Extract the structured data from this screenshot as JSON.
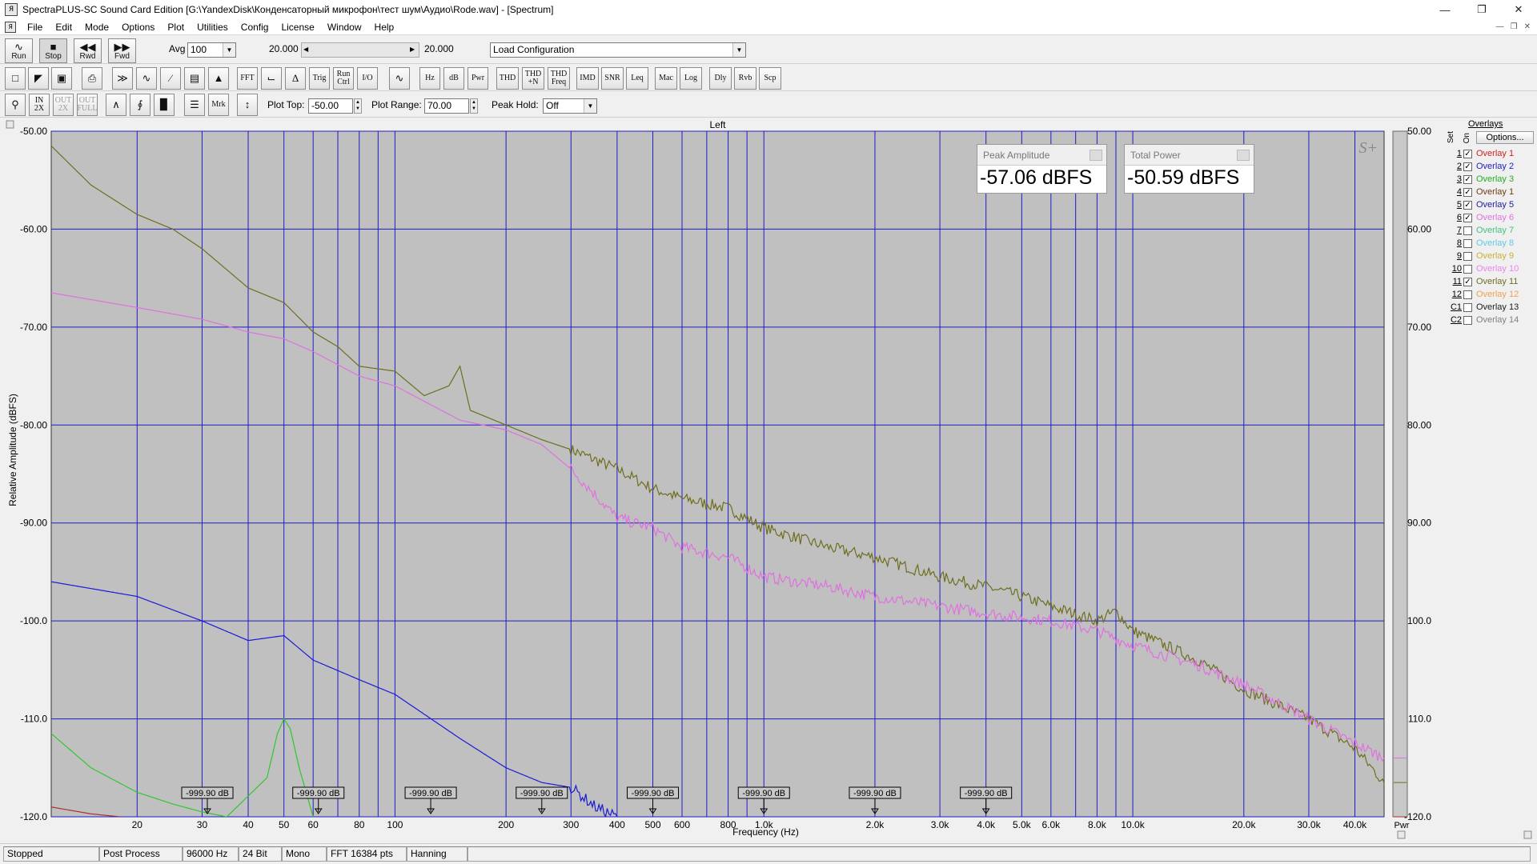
{
  "window": {
    "title": "SpectraPLUS-SC Sound Card Edition [G:\\YandexDisk\\Конденсаторный микрофон\\тест шум\\Аудио\\Rode.wav] - [Spectrum]",
    "app_icon_text": "Я"
  },
  "menu": [
    "File",
    "Edit",
    "Mode",
    "Options",
    "Plot",
    "Utilities",
    "Config",
    "License",
    "Window",
    "Help"
  ],
  "toolbar1": {
    "run_label": "Run",
    "stop_label": "Stop",
    "rwd_label": "Rwd",
    "fwd_label": "Fwd",
    "avg_label": "Avg",
    "avg_value": "100",
    "slider_left": "20.000",
    "slider_right": "20.000",
    "config_value": "Load Configuration"
  },
  "toolbar2": {
    "buttons": [
      "FFT",
      "Trig",
      "Run Ctrl",
      "I/O",
      "Hz",
      "dB",
      "Pwr",
      "THD",
      "THD +N",
      "THD Freq",
      "IMD",
      "SNR",
      "Leq",
      "Mac",
      "Log",
      "Dly",
      "Rvb",
      "Scp"
    ]
  },
  "toolbar3": {
    "mrk_label": "Mrk",
    "plot_top_label": "Plot Top:",
    "plot_top_value": "-50.00",
    "plot_range_label": "Plot Range:",
    "plot_range_value": "70.00",
    "peak_hold_label": "Peak Hold:",
    "peak_hold_value": "Off",
    "zoom_labels": [
      "IN 2X",
      "OUT 2X",
      "OUT FULL"
    ]
  },
  "plot": {
    "title": "Left",
    "logo": "S+",
    "right_axis_footer": "Pwr",
    "peak_amplitude_label": "Peak Amplitude",
    "peak_amplitude_value": "-57.06 dBFS",
    "total_power_label": "Total Power",
    "total_power_value": "-50.59 dBFS",
    "marker_label": "-999.90 dB",
    "bg_color": "#c0c0c0",
    "grid_color": "#1c1cc8"
  },
  "chart_data": {
    "type": "line",
    "xlabel": "Frequency (Hz)",
    "ylabel": "Relative Amplitude (dBFS)",
    "x_scale": "log",
    "xlim": [
      11.7,
      48000
    ],
    "ylim": [
      -120,
      -50
    ],
    "x_ticks": [
      {
        "v": 20,
        "label": "20"
      },
      {
        "v": 30,
        "label": "30"
      },
      {
        "v": 40,
        "label": "40"
      },
      {
        "v": 50,
        "label": "50"
      },
      {
        "v": 60,
        "label": "60"
      },
      {
        "v": 80,
        "label": "80"
      },
      {
        "v": 100,
        "label": "100"
      },
      {
        "v": 200,
        "label": "200"
      },
      {
        "v": 300,
        "label": "300"
      },
      {
        "v": 400,
        "label": "400"
      },
      {
        "v": 500,
        "label": "500"
      },
      {
        "v": 600,
        "label": "600"
      },
      {
        "v": 800,
        "label": "800"
      },
      {
        "v": 1000,
        "label": "1.0k"
      },
      {
        "v": 2000,
        "label": "2.0k"
      },
      {
        "v": 3000,
        "label": "3.0k"
      },
      {
        "v": 4000,
        "label": "4.0k"
      },
      {
        "v": 5000,
        "label": "5.0k"
      },
      {
        "v": 6000,
        "label": "6.0k"
      },
      {
        "v": 8000,
        "label": "8.0k"
      },
      {
        "v": 10000,
        "label": "10.0k"
      },
      {
        "v": 20000,
        "label": "20.0k"
      },
      {
        "v": 30000,
        "label": "30.0k"
      },
      {
        "v": 40000,
        "label": "40.0k"
      }
    ],
    "x_gridlines": [
      20,
      30,
      40,
      50,
      60,
      70,
      80,
      90,
      100,
      200,
      300,
      400,
      500,
      600,
      700,
      800,
      900,
      1000,
      2000,
      3000,
      4000,
      5000,
      6000,
      7000,
      8000,
      9000,
      10000,
      20000,
      30000,
      40000
    ],
    "y_ticks": [
      {
        "v": -50,
        "label": "-50.00"
      },
      {
        "v": -60,
        "label": "-60.00"
      },
      {
        "v": -70,
        "label": "-70.00"
      },
      {
        "v": -80,
        "label": "-80.00"
      },
      {
        "v": -90,
        "label": "-90.00"
      },
      {
        "v": -100,
        "label": "-100.0"
      },
      {
        "v": -110,
        "label": "-110.0"
      },
      {
        "v": -120,
        "label": "-120.0"
      }
    ],
    "markers_hz": [
      31,
      62,
      125,
      250,
      500,
      1000,
      2000,
      4000
    ],
    "series": [
      {
        "color": "#6e6e1e",
        "points": [
          [
            11.7,
            -51.5
          ],
          [
            15,
            -55.5
          ],
          [
            20,
            -58.5
          ],
          [
            25,
            -60
          ],
          [
            30,
            -62
          ],
          [
            40,
            -66
          ],
          [
            50,
            -67.5
          ],
          [
            60,
            -70.5
          ],
          [
            70,
            -72
          ],
          [
            80,
            -74
          ],
          [
            100,
            -74.5
          ],
          [
            120,
            -77
          ],
          [
            140,
            -76
          ],
          [
            150,
            -74
          ],
          [
            160,
            -78.5
          ],
          [
            200,
            -80
          ],
          [
            250,
            -81.5
          ],
          [
            300,
            -82.5
          ],
          [
            400,
            -84.5
          ],
          [
            500,
            -86.5
          ],
          [
            600,
            -87.5
          ],
          [
            800,
            -88.5
          ],
          [
            1000,
            -90.5
          ],
          [
            1500,
            -92.5
          ],
          [
            2000,
            -93.5
          ],
          [
            3000,
            -95.5
          ],
          [
            4000,
            -96.5
          ],
          [
            5000,
            -97.5
          ],
          [
            6000,
            -98.5
          ],
          [
            8000,
            -100
          ],
          [
            9000,
            -99
          ],
          [
            10000,
            -101
          ],
          [
            15000,
            -104
          ],
          [
            20000,
            -107
          ],
          [
            30000,
            -110
          ],
          [
            40000,
            -113
          ],
          [
            48000,
            -116.5
          ]
        ]
      },
      {
        "color": "#e070e0",
        "points": [
          [
            11.7,
            -66.5
          ],
          [
            20,
            -68
          ],
          [
            30,
            -69.2
          ],
          [
            40,
            -70.5
          ],
          [
            50,
            -71.2
          ],
          [
            60,
            -72.5
          ],
          [
            80,
            -75
          ],
          [
            100,
            -76
          ],
          [
            150,
            -79.5
          ],
          [
            200,
            -80.5
          ],
          [
            250,
            -82
          ],
          [
            300,
            -84.5
          ],
          [
            400,
            -89.5
          ],
          [
            500,
            -90.5
          ],
          [
            600,
            -92.5
          ],
          [
            800,
            -93.5
          ],
          [
            1000,
            -95.5
          ],
          [
            1500,
            -96.5
          ],
          [
            2000,
            -97.5
          ],
          [
            3000,
            -98.5
          ],
          [
            4000,
            -99.2
          ],
          [
            6000,
            -100
          ],
          [
            8000,
            -101
          ],
          [
            10000,
            -102.5
          ],
          [
            15000,
            -104.5
          ],
          [
            20000,
            -106.5
          ],
          [
            30000,
            -110
          ],
          [
            40000,
            -112.5
          ],
          [
            48000,
            -114
          ]
        ]
      },
      {
        "color": "#1a1ad8",
        "points": [
          [
            11.7,
            -96
          ],
          [
            20,
            -97.5
          ],
          [
            30,
            -100
          ],
          [
            40,
            -102
          ],
          [
            50,
            -101.5
          ],
          [
            60,
            -104
          ],
          [
            80,
            -106
          ],
          [
            100,
            -107.5
          ],
          [
            150,
            -112
          ],
          [
            200,
            -115
          ],
          [
            250,
            -116.5
          ],
          [
            300,
            -117
          ],
          [
            350,
            -119
          ],
          [
            400,
            -120
          ]
        ]
      },
      {
        "color": "#2ec82e",
        "points": [
          [
            11.7,
            -111.5
          ],
          [
            15,
            -115
          ],
          [
            20,
            -117.5
          ],
          [
            25,
            -118.7
          ],
          [
            30,
            -119.5
          ],
          [
            35,
            -120
          ],
          [
            45,
            -116
          ],
          [
            48,
            -111.5
          ],
          [
            50,
            -110
          ],
          [
            52,
            -111
          ],
          [
            55,
            -115
          ],
          [
            60,
            -120
          ]
        ]
      },
      {
        "color": "#a83030",
        "points": [
          [
            11.7,
            -119
          ],
          [
            15,
            -119.7
          ],
          [
            18,
            -120
          ]
        ]
      }
    ]
  },
  "overlays": [
    {
      "set": "1",
      "checked": true,
      "name": "Overlay 1",
      "color": "#d02020"
    },
    {
      "set": "2",
      "checked": true,
      "name": "Overlay 2",
      "color": "#2020c0"
    },
    {
      "set": "3",
      "checked": true,
      "name": "Overlay 3",
      "color": "#20b020"
    },
    {
      "set": "4",
      "checked": true,
      "name": "Overlay 1",
      "color": "#6e3a10"
    },
    {
      "set": "5",
      "checked": true,
      "name": "Overlay 5",
      "color": "#2020a0"
    },
    {
      "set": "6",
      "checked": true,
      "name": "Overlay 6",
      "color": "#e070e0"
    },
    {
      "set": "7",
      "checked": false,
      "name": "Overlay 7",
      "color": "#40c080"
    },
    {
      "set": "8",
      "checked": false,
      "name": "Overlay 8",
      "color": "#60c8e8"
    },
    {
      "set": "9",
      "checked": false,
      "name": "Overlay 9",
      "color": "#c8b030"
    },
    {
      "set": "10",
      "checked": false,
      "name": "Overlay 10",
      "color": "#f080f0"
    },
    {
      "set": "11",
      "checked": true,
      "name": "Overlay 11",
      "color": "#6e6e1e"
    },
    {
      "set": "12",
      "checked": false,
      "name": "Overlay 12",
      "color": "#f0a050"
    },
    {
      "set": "C1",
      "checked": false,
      "name": "Overlay 13",
      "color": "#202020"
    },
    {
      "set": "C2",
      "checked": false,
      "name": "Overlay 14",
      "color": "#808080"
    }
  ],
  "overlay_header": {
    "title": "Overlays",
    "set": "Set",
    "on": "On",
    "options": "Options..."
  },
  "status": [
    "Stopped",
    "Post Process",
    "96000 Hz",
    "24 Bit",
    "Mono",
    "FFT 16384 pts",
    "Hanning"
  ]
}
